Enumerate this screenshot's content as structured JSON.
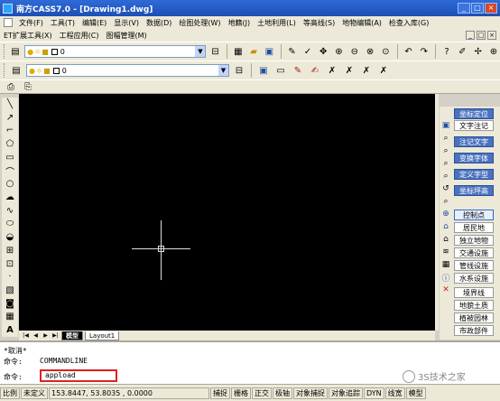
{
  "window": {
    "title": "南方CASS7.0 - [Drawing1.dwg]",
    "min": "_",
    "max": "□",
    "close": "×"
  },
  "menu1": [
    "文件(F)",
    "工具(T)",
    "编辑(E)",
    "显示(V)",
    "数据(D)",
    "绘图处理(W)",
    "地籍(J)",
    "土地利用(L)",
    "等高线(S)",
    "地物编辑(A)",
    "检查入库(G)"
  ],
  "menu2": [
    "ET扩展工具(X)",
    "工程应用(C)",
    "图幅管理(M)"
  ],
  "mdi_buttons": [
    "_",
    "□",
    "×"
  ],
  "toolbar1": {
    "layer_value": "0"
  },
  "toolbar2": {
    "layer_value": "0"
  },
  "tabs": {
    "model": "模型",
    "layout": "Layout1"
  },
  "side_panel": {
    "buttons": [
      "坐标定位",
      "文字注记",
      "注记文字",
      "变换字体",
      "定义字型",
      "坐标坪高",
      "控制点",
      "居民地",
      "独立地物",
      "交通设施",
      "管线设施",
      "水系设施",
      "境界线",
      "地貌土质",
      "植被园林",
      "市政部件"
    ]
  },
  "command": {
    "line1": "*取消*",
    "line2_label": "命令:",
    "line2_value": "COMMANDLINE",
    "line3_label": "命令:",
    "input_value": "appload"
  },
  "status": {
    "scale_label": "比例",
    "scale_value": "未定义",
    "coords": "153.8447, 53.8035 , 0.0000",
    "toggles": [
      "捕捉",
      "栅格",
      "正交",
      "极轴",
      "对象捕捉",
      "对象追踪",
      "DYN",
      "线宽",
      "模型"
    ]
  },
  "watermark": "3S技术之家"
}
